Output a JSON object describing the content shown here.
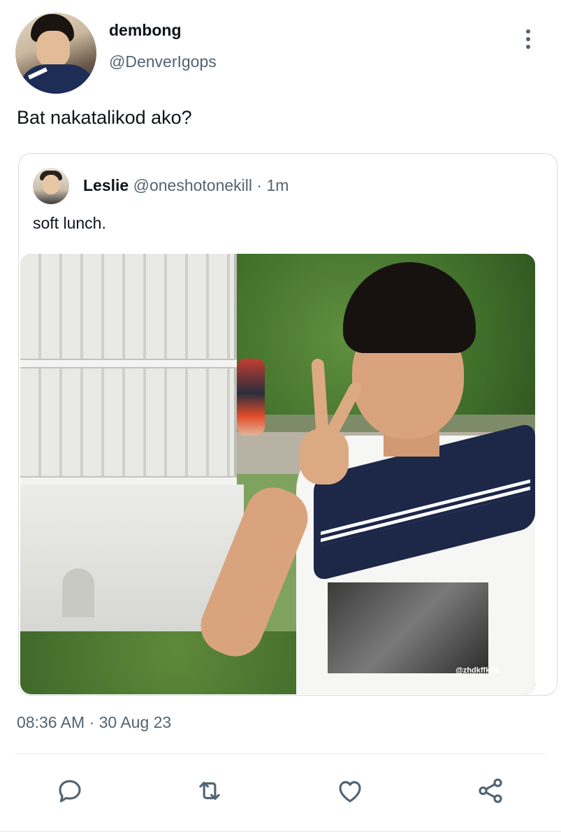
{
  "tweet": {
    "author": {
      "display_name": "dembong",
      "handle": "@DenverIgops"
    },
    "text": "Bat nakatalikod ako?",
    "timestamp": "08:36 AM · 30 Aug 23"
  },
  "quoted": {
    "display_name": "Leslie",
    "handle": "@oneshotonekill",
    "separator": "·",
    "time": "1m",
    "text": "soft lunch.",
    "media_watermark": "@zhdkffkRb"
  },
  "actions": {
    "reply": "reply-icon",
    "retweet": "retweet-icon",
    "like": "heart-icon",
    "share": "share-icon"
  },
  "colors": {
    "text_primary": "#0f1419",
    "text_secondary": "#536471",
    "border": "#d5dbe0",
    "icon": "#536471"
  }
}
